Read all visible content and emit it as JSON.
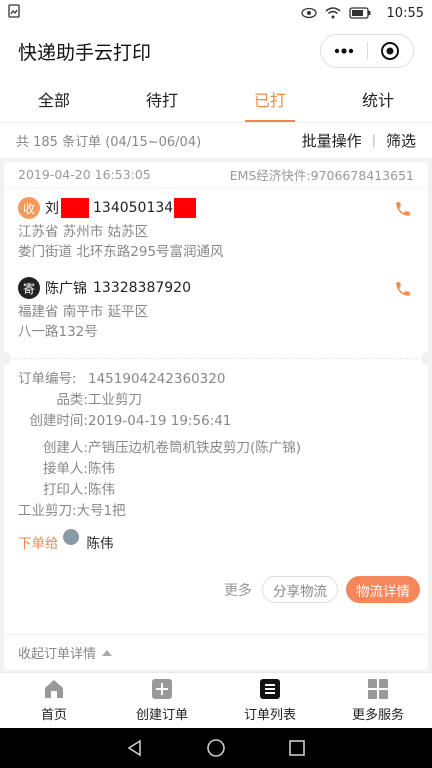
{
  "status_bar": {
    "time": "10:55"
  },
  "header": {
    "title": "快递助手云打印"
  },
  "tabs": [
    {
      "label": "全部"
    },
    {
      "label": "待打"
    },
    {
      "label": "已打"
    },
    {
      "label": "统计"
    }
  ],
  "active_tab": "已打",
  "summary": {
    "count_text": "共 185 条订单 (04/15~06/04)",
    "batch_label": "批量操作",
    "separator": "|",
    "filter_label": "筛选"
  },
  "order": {
    "datetime": "2019-04-20 16:53:05",
    "carrier": "EMS经济快件:9706678413651",
    "receiver": {
      "badge": "收",
      "name_visible": "刘",
      "phone_visible": "134050134",
      "province_city": "江苏省 苏州市 姑苏区",
      "street": "娄门街道 北环东路295号富润通风"
    },
    "sender": {
      "badge": "寄",
      "name": "陈广锦",
      "phone": "13328387920",
      "province_city": "福建省 南平市 延平区",
      "street": "八一路132号"
    },
    "details": {
      "order_no_label": "订单编号:",
      "order_no": "1451904242360320",
      "category_label": "品类:",
      "category": "工业剪刀",
      "created_time_label": "创建时间:",
      "created_time": "2019-04-19 19:56:41",
      "creator_label": "创建人:",
      "creator": "产销压边机卷筒机铁皮剪刀(陈广锦)",
      "receiver_op_label": "接单人:",
      "receiver_op": "陈伟",
      "printer_label": "打印人:",
      "printer": "陈伟",
      "goods": "工业剪刀:大号1把"
    },
    "assign": {
      "label": "下单给",
      "name": "陈伟"
    },
    "actions": {
      "more": "更多",
      "share": "分享物流",
      "detail": "物流详情"
    },
    "collapse_label": "收起订单详情"
  },
  "bottom_nav": [
    {
      "label": "首页",
      "icon": "home-icon"
    },
    {
      "label": "创建订单",
      "icon": "add-order-icon"
    },
    {
      "label": "订单列表",
      "icon": "order-list-icon"
    },
    {
      "label": "更多服务",
      "icon": "grid-icon"
    }
  ],
  "colors": {
    "accent": "#f08a46",
    "button": "#f5875a",
    "redaction": "#ff0000"
  }
}
